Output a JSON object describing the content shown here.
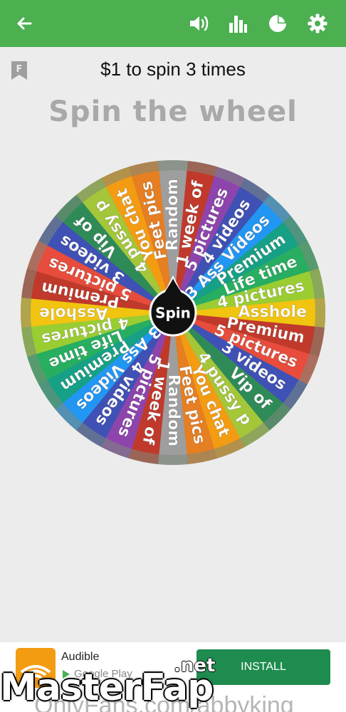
{
  "appbar": {
    "color": "#4caf50",
    "icons": [
      "back-arrow-icon",
      "volume-icon",
      "bar-chart-icon",
      "pie-chart-icon",
      "gear-icon"
    ]
  },
  "header": {
    "bookmark_letter": "F",
    "subtitle": "$1 to spin 3 times",
    "title": "Spin the wheel"
  },
  "wheel": {
    "center_label": "Spin",
    "segments": [
      {
        "label": "Random",
        "color": "#9e9e9e"
      },
      {
        "label": "1 week of",
        "color": "#c0392b"
      },
      {
        "label": "5 pictures",
        "color": "#8e44ad"
      },
      {
        "label": "4 videos",
        "color": "#3f51b5"
      },
      {
        "label": "3 Ass Videos",
        "color": "#2196f3"
      },
      {
        "label": "Premium",
        "color": "#16a085"
      },
      {
        "label": "Life time",
        "color": "#27ae60"
      },
      {
        "label": "4 pictures",
        "color": "#9acd32"
      },
      {
        "label": "Asshole",
        "color": "#f1c40f"
      },
      {
        "label": "Premium",
        "color": "#c0392b"
      },
      {
        "label": "5 pictures",
        "color": "#e74c3c"
      },
      {
        "label": "3 videos",
        "color": "#3f51b5"
      },
      {
        "label": "Vip of",
        "color": "#2e8b57"
      },
      {
        "label": "4 pussy p",
        "color": "#a4c639"
      },
      {
        "label": "You chat",
        "color": "#f39c12"
      },
      {
        "label": "Feet pics",
        "color": "#e67e22"
      },
      {
        "label": "Random",
        "color": "#9e9e9e"
      },
      {
        "label": "1 week of",
        "color": "#c0392b"
      },
      {
        "label": "5 pictures",
        "color": "#8e44ad"
      },
      {
        "label": "4 videos",
        "color": "#3f51b5"
      },
      {
        "label": "3 Ass Videos",
        "color": "#2196f3"
      },
      {
        "label": "Premium",
        "color": "#16a085"
      },
      {
        "label": "Life time",
        "color": "#27ae60"
      },
      {
        "label": "4 pictures",
        "color": "#9acd32"
      },
      {
        "label": "Asshole",
        "color": "#f1c40f"
      },
      {
        "label": "Premium",
        "color": "#c0392b"
      },
      {
        "label": "5 pictures",
        "color": "#e74c3c"
      },
      {
        "label": "3 videos",
        "color": "#3f51b5"
      },
      {
        "label": "Vip of",
        "color": "#2e8b57"
      },
      {
        "label": "4 pussy p",
        "color": "#a4c639"
      },
      {
        "label": "You chat",
        "color": "#f39c12"
      },
      {
        "label": "Feet pics",
        "color": "#e67e22"
      }
    ]
  },
  "ad": {
    "app_name": "Audible",
    "store": "Google Play",
    "install_label": "INSTALL"
  },
  "watermark": {
    "main": "MasterFap",
    "net": ".net",
    "of": "OnlyFans.com/abbyking"
  }
}
